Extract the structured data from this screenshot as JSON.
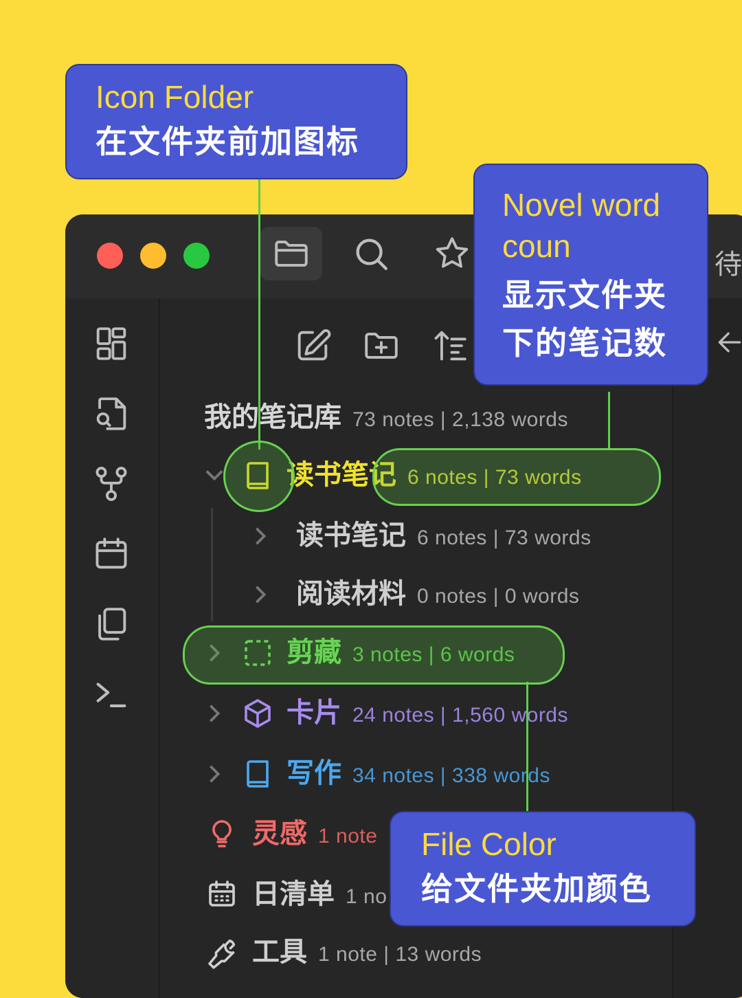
{
  "titlebar": {
    "traffic_lights": [
      "close",
      "minimize",
      "zoom"
    ],
    "tab_icons": [
      "folder-icon",
      "search-icon",
      "star-icon"
    ],
    "tab_title": "待"
  },
  "ribbon": {
    "icons": [
      "dashboard-icon",
      "file-search-icon",
      "git-fork-icon",
      "calendar-icon",
      "copy-icon",
      "terminal-icon"
    ]
  },
  "explorer": {
    "toolbar_icons": [
      "new-note-icon",
      "new-folder-icon",
      "sort-icon"
    ],
    "vault": {
      "name": "我的笔记库",
      "count": "73 notes | 2,138 words"
    },
    "folders": [
      {
        "name": "读书笔记",
        "count": "6 notes | 73 words",
        "color": "#F0E22C",
        "icon": "book-icon",
        "expanded": true
      },
      {
        "name": "读书笔记",
        "count": "6 notes | 73 words",
        "color": "#cfcfcf",
        "icon": "none",
        "nested": true
      },
      {
        "name": "阅读材料",
        "count": "0 notes | 0 words",
        "color": "#cfcfcf",
        "icon": "none",
        "nested": true
      },
      {
        "name": "剪藏",
        "count": "3 notes | 6 words",
        "color": "#6BE05A",
        "icon": "dashed-square-icon"
      },
      {
        "name": "卡片",
        "count": "24 notes | 1,560 words",
        "color": "#A98BF0",
        "icon": "box-icon"
      },
      {
        "name": "写作",
        "count": "34 notes | 338 words",
        "color": "#4BA8EE",
        "icon": "book-icon"
      },
      {
        "name": "灵感",
        "count": "1 note",
        "color": "#F06A6A",
        "icon": "lightbulb-icon"
      },
      {
        "name": "日清单",
        "count": "1 no",
        "color": "#cfcfcf",
        "icon": "calendar-icon"
      },
      {
        "name": "工具",
        "count": "1 note | 13 words",
        "color": "#cfcfcf",
        "icon": "wrench-icon"
      }
    ]
  },
  "callouts": {
    "icon_folder": {
      "title": "Icon Folder",
      "subtitle": "在文件夹前加图标"
    },
    "novel_word_count": {
      "title_line1": "Novel word",
      "title_line2": "coun",
      "subtitle_line1": "显示文件夹",
      "subtitle_line2": "下的笔记数"
    },
    "file_color": {
      "title": "File Color",
      "subtitle": "给文件夹加颜色"
    }
  },
  "colors": {
    "background": "#FCDB3C",
    "callout": "#4A57D2",
    "highlight": "#67D14F",
    "callout_title": "#FCDB3C"
  }
}
